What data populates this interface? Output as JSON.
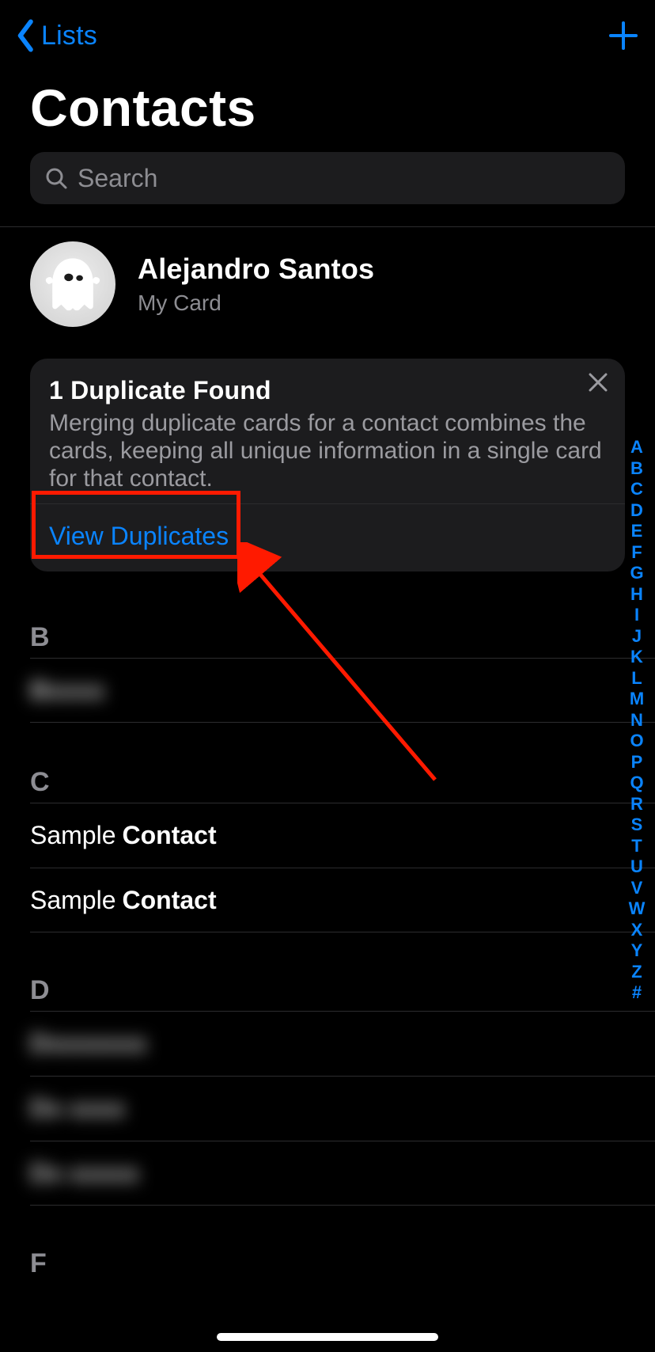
{
  "nav": {
    "back_label": "Lists"
  },
  "title": "Contacts",
  "search": {
    "placeholder": "Search"
  },
  "my_card": {
    "name": "Alejandro Santos",
    "sub": "My Card"
  },
  "duplicates": {
    "title": "1 Duplicate Found",
    "desc": "Merging duplicate cards for a contact combines the cards, keeping all unique information in a single card for that contact.",
    "action": "View Duplicates"
  },
  "sections": {
    "b": {
      "header": "B",
      "rows": [
        {
          "first": "Bxxxx",
          "last": "",
          "blur": true
        }
      ]
    },
    "c": {
      "header": "C",
      "rows": [
        {
          "first": "Sample",
          "last": "Contact",
          "blur": false
        },
        {
          "first": "Sample",
          "last": "Contact",
          "blur": false
        }
      ]
    },
    "d": {
      "header": "D",
      "rows": [
        {
          "first": "Dxxxxxxx",
          "last": "",
          "blur": true
        },
        {
          "first": "Dx",
          "last": "xxxx",
          "blur": true
        },
        {
          "first": "Dx",
          "last": "xxxxx",
          "blur": true
        }
      ]
    },
    "f": {
      "header": "F"
    }
  },
  "index": [
    "A",
    "B",
    "C",
    "D",
    "E",
    "F",
    "G",
    "H",
    "I",
    "J",
    "K",
    "L",
    "M",
    "N",
    "O",
    "P",
    "Q",
    "R",
    "S",
    "T",
    "U",
    "V",
    "W",
    "X",
    "Y",
    "Z",
    "#"
  ]
}
